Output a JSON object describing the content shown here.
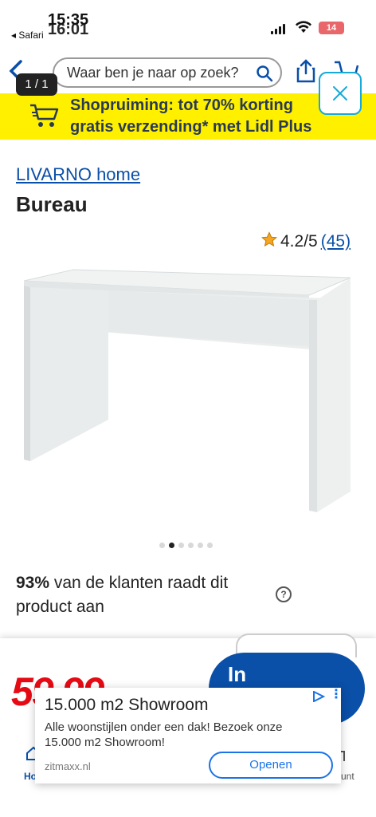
{
  "status_bar": {
    "time": "15:35",
    "time_ghost": "16:01",
    "back_app": "◂ Safari",
    "battery": "14"
  },
  "nav": {
    "search_placeholder": "Waar ben je naar op zoek?",
    "page_counter": "1 / 1"
  },
  "banner": {
    "line1": "Shopruiming: tot 70% korting",
    "line2": "gratis verzending* met Lidl Plus",
    "color": "#fff000"
  },
  "product": {
    "brand": "LIVARNO home",
    "title": "Bureau",
    "rating": "4.2/5",
    "review_count": "(45)",
    "image_dots": 6,
    "active_dot": 1,
    "recommend_pct": "93%",
    "recommend_text": " van de klanten raadt dit product aan",
    "price_fragment": "59.99",
    "cart_button": "In"
  },
  "tabs": {
    "home_label": "Ho",
    "right_label": "unt"
  },
  "ad": {
    "title": "15.000 m2 Showroom",
    "description": "Alle woonstijlen onder een dak! Bezoek onze 15.000 m2 Showroom!",
    "domain": "zitmaxx.nl",
    "button": "Openen"
  },
  "colors": {
    "accent_blue": "#0a4fa8",
    "price_red": "#e60a14",
    "ad_blue": "#1a73e8"
  }
}
